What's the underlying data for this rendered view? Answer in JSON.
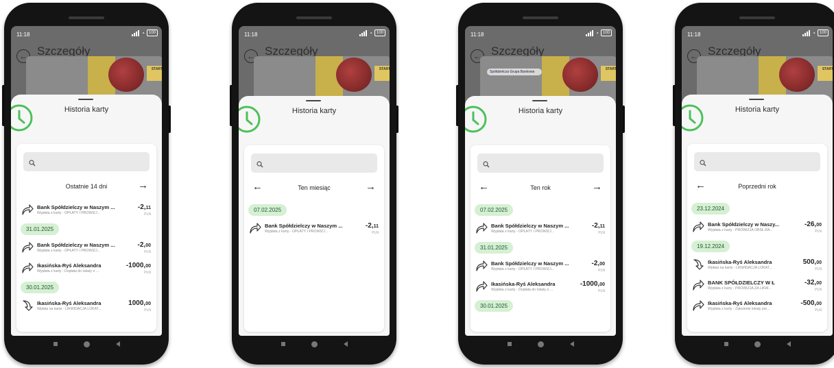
{
  "status": {
    "time": "11:18",
    "battery": "100"
  },
  "app": {
    "back_icon": "back-arrow-icon",
    "title": "Szczegóły karty"
  },
  "card_art": {
    "start_label": "START",
    "bank_name": "Spółdzielcza Grupa Bankowa"
  },
  "sheet": {
    "title": "Historia karty",
    "icon": "history-clock-icon",
    "icon_color": "#4cc05a"
  },
  "colors": {
    "date_chip_bg": "#d5f0d2",
    "accent_green": "#4cc05a"
  },
  "screens": [
    {
      "period": "Ostatnie 14 dni",
      "items": [
        {
          "kind": "tx",
          "dir": "out",
          "name": "Bank Spółdzielczy w Naszym ...",
          "desc": "Wypłata z karty - OPŁATY I PROWIZJ...",
          "amount_main": "-2,",
          "amount_cents": "11",
          "currency": "PLN"
        },
        {
          "kind": "date",
          "label": "31.01.2025"
        },
        {
          "kind": "tx",
          "dir": "out",
          "name": "Bank Spółdzielczy w Naszym ...",
          "desc": "Wypłata z karty - OPŁATY I PROWIZJ...",
          "amount_main": "-2,",
          "amount_cents": "00",
          "currency": "PLN"
        },
        {
          "kind": "tx",
          "dir": "out",
          "name": "Ikasińska-Ryś Aleksandra",
          "desc": "Wypłata z karty - Dopłata do lokaty o ...",
          "amount_main": "-1000,",
          "amount_cents": "00",
          "currency": "PLN"
        },
        {
          "kind": "date",
          "label": "30.01.2025"
        },
        {
          "kind": "tx",
          "dir": "in",
          "name": "Ikasińska-Ryś Aleksandra",
          "desc": "Wpłata na kartę - LIKWIDACJA LOKAT...",
          "amount_main": "1000,",
          "amount_cents": "00",
          "currency": "PLN"
        }
      ]
    },
    {
      "period": "Ten miesiąc",
      "items": [
        {
          "kind": "date",
          "label": "07.02.2025"
        },
        {
          "kind": "tx",
          "dir": "out",
          "name": "Bank Spółdzielczy w Naszym ...",
          "desc": "Wypłata z karty - OPŁATY I PROWIZJ...",
          "amount_main": "-2,",
          "amount_cents": "11",
          "currency": "PLN"
        }
      ]
    },
    {
      "period": "Ten rok",
      "items": [
        {
          "kind": "date",
          "label": "07.02.2025"
        },
        {
          "kind": "tx",
          "dir": "out",
          "name": "Bank Spółdzielczy w Naszym ...",
          "desc": "Wypłata z karty - OPŁATY I PROWIZJ...",
          "amount_main": "-2,",
          "amount_cents": "11",
          "currency": "PLN"
        },
        {
          "kind": "date",
          "label": "31.01.2025"
        },
        {
          "kind": "tx",
          "dir": "out",
          "name": "Bank Spółdzielczy w Naszym ...",
          "desc": "Wypłata z karty - OPŁATY I PROWIZJ...",
          "amount_main": "-2,",
          "amount_cents": "00",
          "currency": "PLN"
        },
        {
          "kind": "tx",
          "dir": "out",
          "name": "Ikasińska-Ryś Aleksandra",
          "desc": "Wypłata z karty - Dopłata do lokaty o ...",
          "amount_main": "-1000,",
          "amount_cents": "00",
          "currency": "PLN"
        },
        {
          "kind": "date",
          "label": "30.01.2025"
        }
      ]
    },
    {
      "period": "Poprzedni rok",
      "items": [
        {
          "kind": "date",
          "label": "23.12.2024"
        },
        {
          "kind": "tx",
          "dir": "out",
          "name": "Bank Spółdzielczy w Naszy...",
          "desc": "Wypłata z karty - PROWIZJA OBSŁ.RA...",
          "amount_main": "-26,",
          "amount_cents": "00",
          "currency": "PLN"
        },
        {
          "kind": "date",
          "label": "19.12.2024"
        },
        {
          "kind": "tx",
          "dir": "in",
          "name": "Ikasińska-Ryś Aleksandra",
          "desc": "Wpłata na kartę - LIKWIDACJA LOKAT...",
          "amount_main": "500,",
          "amount_cents": "00",
          "currency": "PLN"
        },
        {
          "kind": "tx",
          "dir": "out",
          "name": "BANK SPÓŁDZIELCZY W Ł",
          "desc": "Wypłata z karty - PROWIZJA ZA LIKW...",
          "amount_main": "-32,",
          "amount_cents": "00",
          "currency": "PLN"
        },
        {
          "kind": "tx",
          "dir": "out",
          "name": "Ikasińska-Ryś Aleksandra",
          "desc": "Wypłata z karty - Założenie lokaty prz...",
          "amount_main": "-500,",
          "amount_cents": "00",
          "currency": "PLN"
        }
      ]
    }
  ]
}
